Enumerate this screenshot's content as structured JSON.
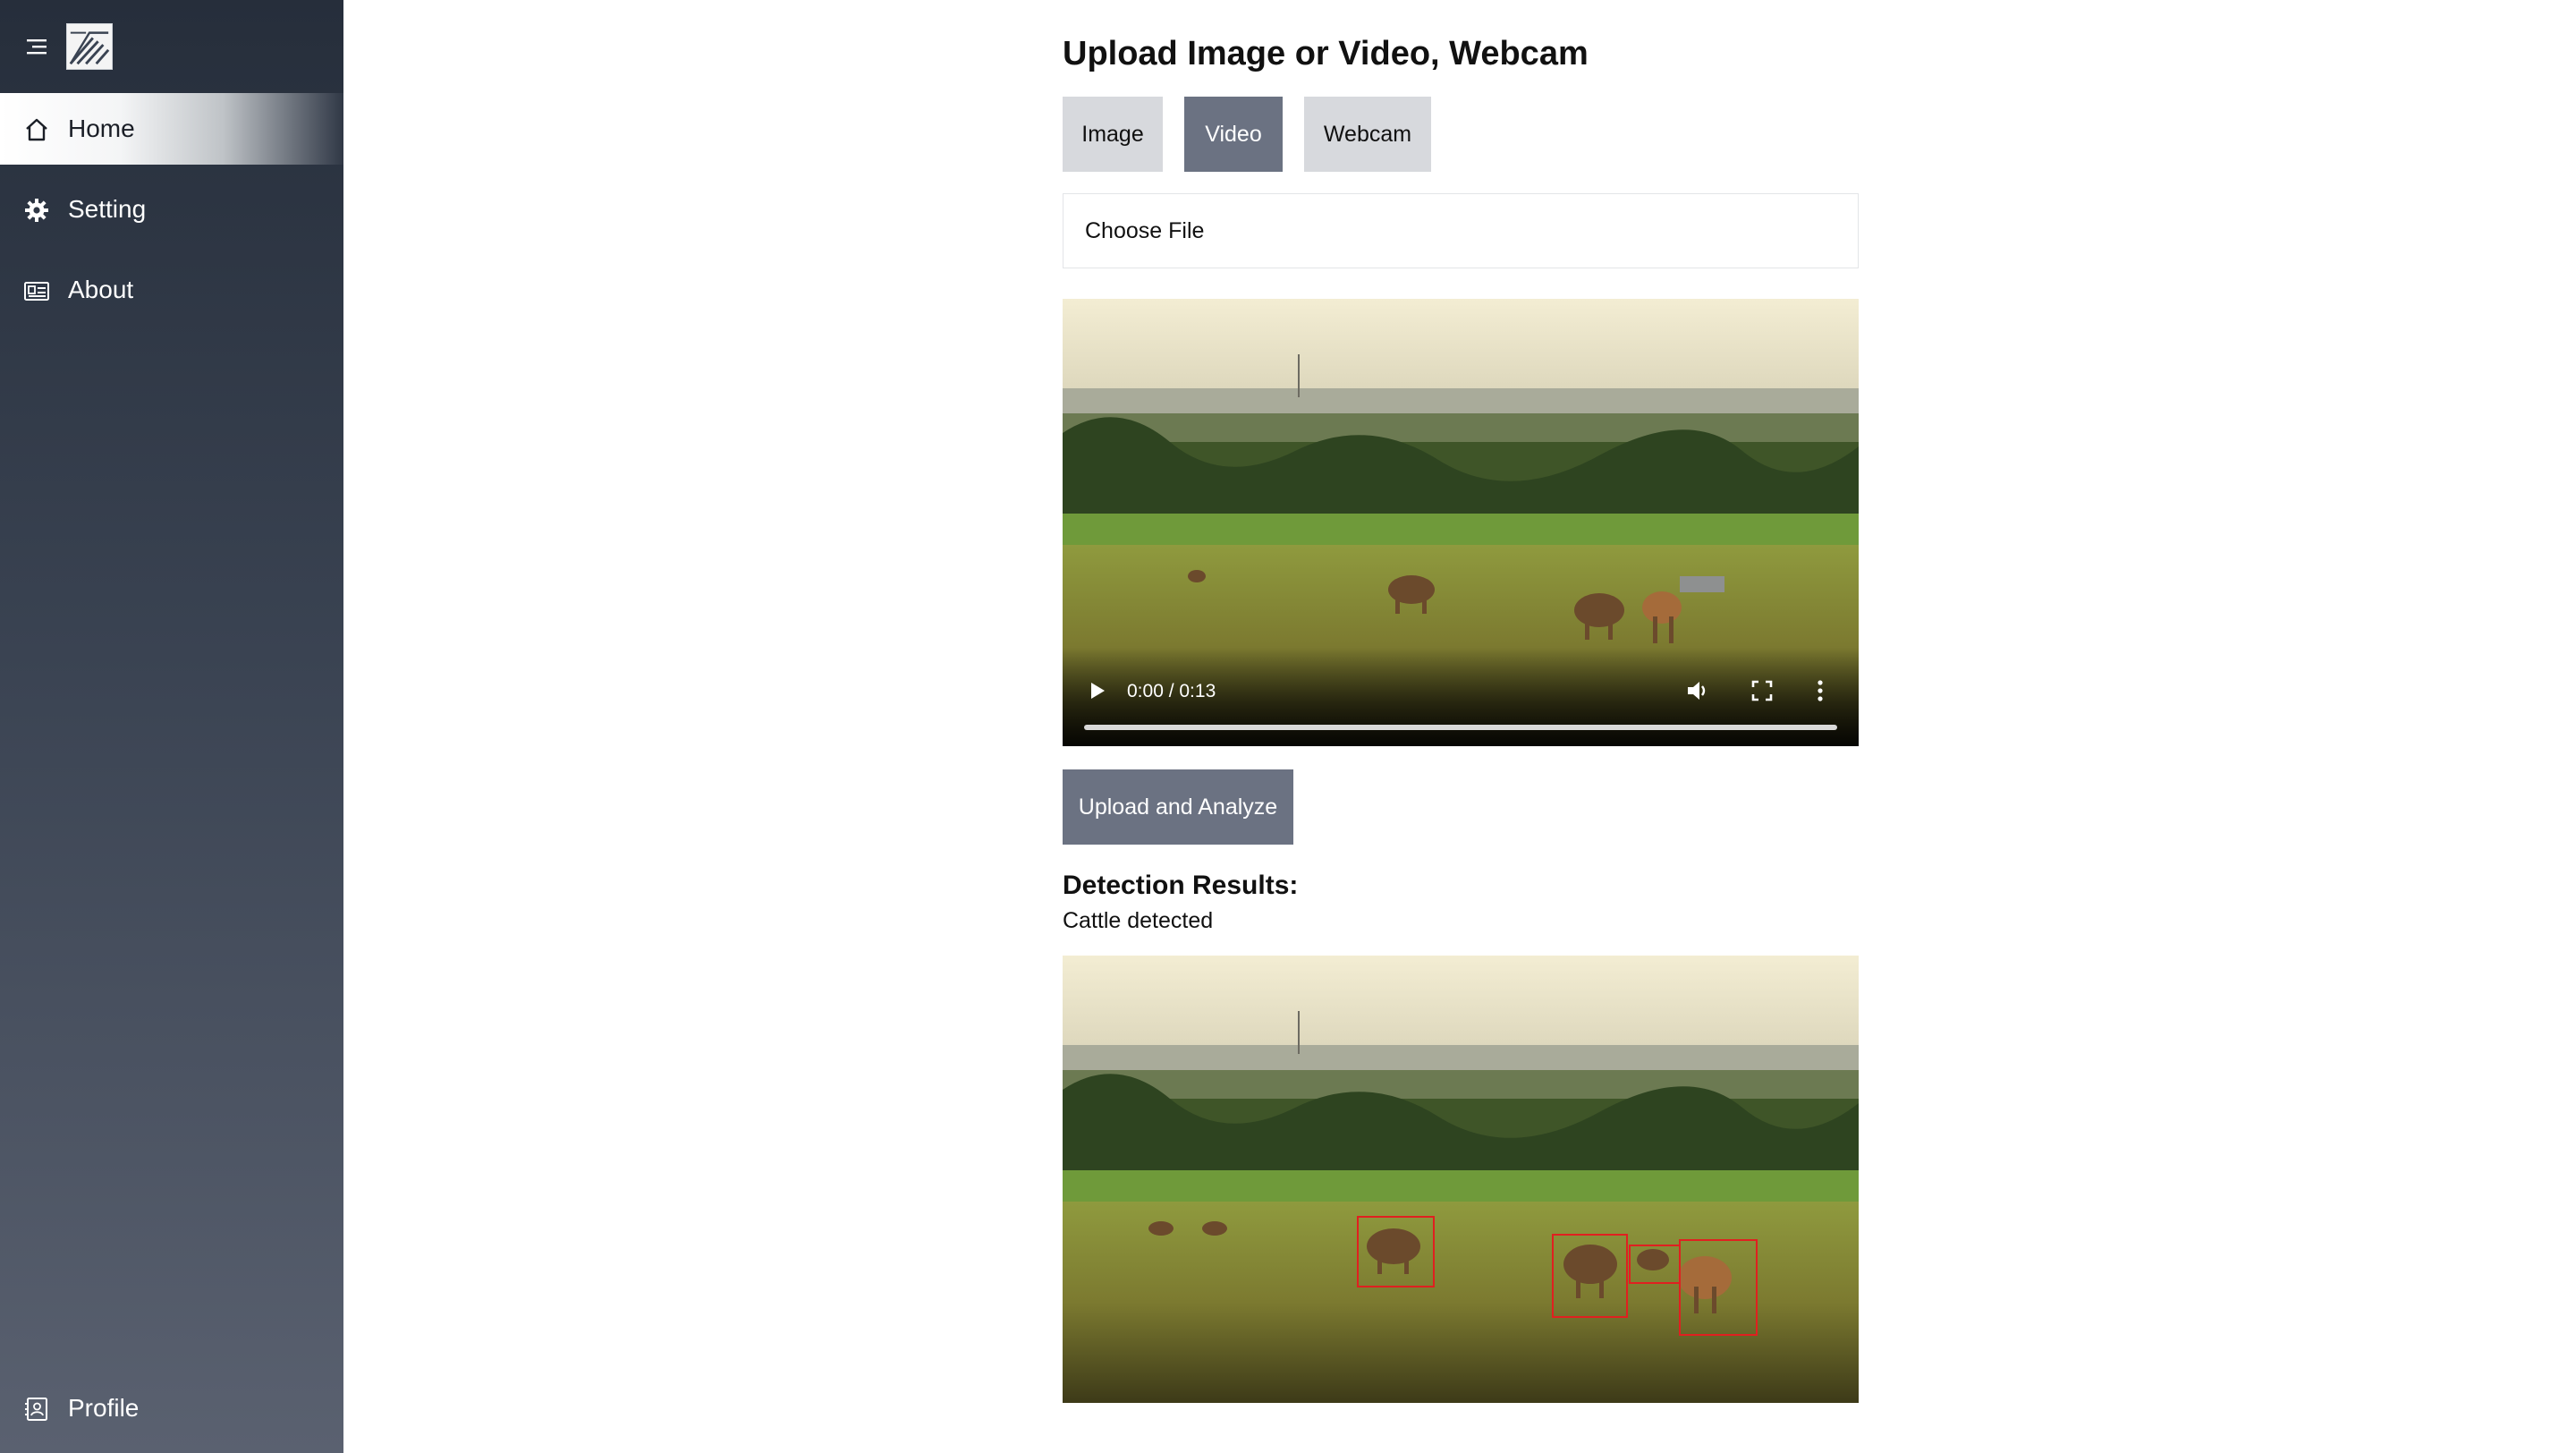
{
  "sidebar": {
    "items": [
      {
        "label": "Home",
        "icon": "home-icon",
        "active": true
      },
      {
        "label": "Setting",
        "icon": "gear-icon",
        "active": false
      },
      {
        "label": "About",
        "icon": "id-card-icon",
        "active": false
      }
    ],
    "profile": {
      "label": "Profile",
      "icon": "contact-icon"
    }
  },
  "main": {
    "title": "Upload Image or Video, Webcam",
    "tabs": [
      {
        "label": "Image",
        "selected": false
      },
      {
        "label": "Video",
        "selected": true
      },
      {
        "label": "Webcam",
        "selected": false
      }
    ],
    "file_input_label": "Choose File",
    "video": {
      "time": "0:00 / 0:13"
    },
    "upload_button": "Upload and Analyze",
    "results": {
      "heading": "Detection Results:",
      "text": "Cattle detected"
    }
  },
  "colors": {
    "sidebar_top": "#262e3b",
    "sidebar_bottom": "#5a6170",
    "button_active": "#6b7282",
    "button_inactive": "#d7d9dd",
    "detection_box": "#e02020"
  }
}
